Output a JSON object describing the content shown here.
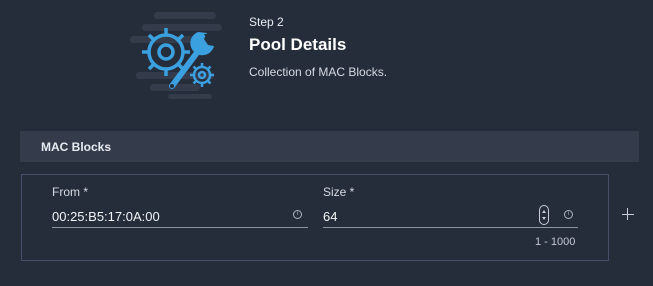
{
  "header": {
    "step": "Step 2",
    "title": "Pool Details",
    "description": "Collection of MAC Blocks.",
    "illustration_icon": "settings-wrench-icon",
    "accent_color": "#3aa0e0"
  },
  "section": {
    "title": "MAC Blocks"
  },
  "block": {
    "from": {
      "label": "From *",
      "value": "00:25:B5:17:0A:00",
      "info_icon": "info-icon"
    },
    "size": {
      "label": "Size *",
      "value": "64",
      "range": "1 - 1000",
      "info_icon": "info-icon"
    },
    "add_icon": "plus-icon"
  }
}
